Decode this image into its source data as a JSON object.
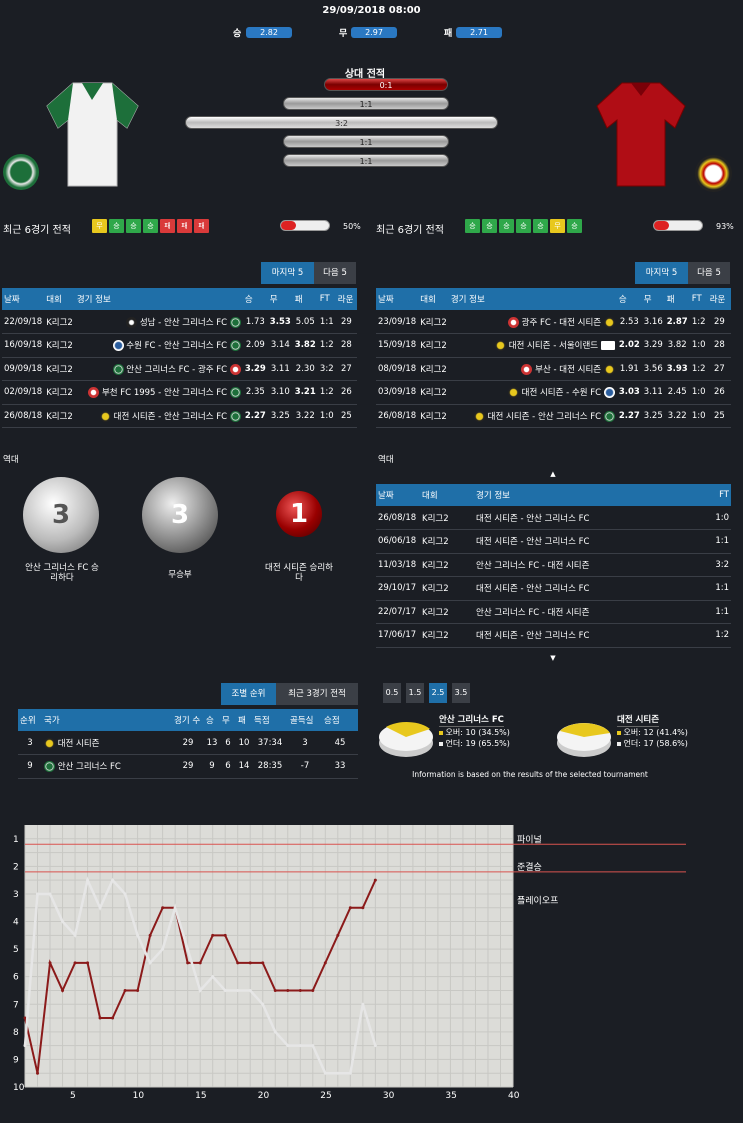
{
  "match": {
    "datetime": "29/09/2018 08:00"
  },
  "odds": {
    "win_label": "승",
    "win": "2.82",
    "draw_label": "무",
    "draw": "2.97",
    "loss_label": "패",
    "loss": "2.71"
  },
  "h2h": {
    "title": "상대 전적",
    "bars": [
      "0:1",
      "1:1",
      "3:2",
      "1:1",
      "1:1"
    ]
  },
  "recent": {
    "label": "최근 6경기 전적",
    "home": {
      "badges": [
        "무",
        "승",
        "승",
        "승",
        "패",
        "패",
        "패"
      ],
      "pct": "50%"
    },
    "away": {
      "badges": [
        "승",
        "승",
        "승",
        "승",
        "승",
        "무",
        "승"
      ],
      "pct": "93%"
    }
  },
  "tabs": {
    "last5": "마지막 5",
    "next5": "다음 5"
  },
  "lastHeaders": {
    "date": "날짜",
    "comp": "대회",
    "info": "경기 정보",
    "w": "승",
    "d": "무",
    "l": "패",
    "ft": "FT",
    "round": "라운"
  },
  "homeLast": [
    {
      "date": "22/09/18",
      "comp": "K리그2",
      "home": "성남",
      "away": "안산 그리너스 FC",
      "w": "1.73",
      "d": "3.53",
      "l": "5.05",
      "ft": "1:1",
      "r": "29"
    },
    {
      "date": "16/09/18",
      "comp": "K리그2",
      "home": "수원 FC",
      "away": "안산 그리너스 FC",
      "w": "2.09",
      "d": "3.14",
      "l": "3.82",
      "ft": "1:2",
      "r": "28"
    },
    {
      "date": "09/09/18",
      "comp": "K리그2",
      "home": "안산 그리너스 FC",
      "away": "광주 FC",
      "w": "3.29",
      "d": "3.11",
      "l": "2.30",
      "ft": "3:2",
      "r": "27"
    },
    {
      "date": "02/09/18",
      "comp": "K리그2",
      "home": "부천 FC 1995",
      "away": "안산 그리너스 FC",
      "w": "2.35",
      "d": "3.10",
      "l": "3.21",
      "ft": "1:2",
      "r": "26"
    },
    {
      "date": "26/08/18",
      "comp": "K리그2",
      "home": "대전 시티즌",
      "away": "안산 그리너스 FC",
      "w": "2.27",
      "d": "3.25",
      "l": "3.22",
      "ft": "1:0",
      "r": "25"
    }
  ],
  "awayLast": [
    {
      "date": "23/09/18",
      "comp": "K리그2",
      "home": "광주 FC",
      "away": "대전 시티즌",
      "w": "2.53",
      "d": "3.16",
      "l": "2.87",
      "ft": "1:2",
      "r": "29"
    },
    {
      "date": "15/09/18",
      "comp": "K리그2",
      "home": "대전 시티즌",
      "away": "서울이랜드",
      "w": "2.02",
      "d": "3.29",
      "l": "3.82",
      "ft": "1:0",
      "r": "28"
    },
    {
      "date": "08/09/18",
      "comp": "K리그2",
      "home": "부산",
      "away": "대전 시티즌",
      "w": "1.91",
      "d": "3.56",
      "l": "3.93",
      "ft": "1:2",
      "r": "27"
    },
    {
      "date": "03/09/18",
      "comp": "K리그2",
      "home": "대전 시티즌",
      "away": "수원 FC",
      "w": "3.03",
      "d": "3.11",
      "l": "2.45",
      "ft": "1:0",
      "r": "26"
    },
    {
      "date": "26/08/18",
      "comp": "K리그2",
      "home": "대전 시티즌",
      "away": "안산 그리너스 FC",
      "w": "2.27",
      "d": "3.25",
      "l": "3.22",
      "ft": "1:0",
      "r": "25"
    }
  ],
  "history": {
    "title": "역대",
    "home_wins": "3",
    "home_label": "안산 그리너스 FC 승리하다",
    "draws": "3",
    "draw_label": "무승부",
    "away_wins": "1",
    "away_label": "대전 시티즌 승리하다"
  },
  "histTable": {
    "headers": {
      "date": "날짜",
      "comp": "대회",
      "info": "경기 정보",
      "ft": "FT"
    },
    "rows": [
      {
        "date": "26/08/18",
        "comp": "K리그2",
        "home": "대전 시티즌",
        "away": "안산 그리너스 FC",
        "ft": "1:0"
      },
      {
        "date": "06/06/18",
        "comp": "K리그2",
        "home": "대전 시티즌",
        "away": "안산 그리너스 FC",
        "ft": "1:1"
      },
      {
        "date": "11/03/18",
        "comp": "K리그2",
        "home": "안산 그리너스 FC",
        "away": "대전 시티즌",
        "ft": "3:2"
      },
      {
        "date": "29/10/17",
        "comp": "K리그2",
        "home": "대전 시티즌",
        "away": "안산 그리너스 FC",
        "ft": "1:1"
      },
      {
        "date": "22/07/17",
        "comp": "K리그2",
        "home": "안산 그리너스 FC",
        "away": "대전 시티즌",
        "ft": "1:1"
      },
      {
        "date": "17/06/17",
        "comp": "K리그2",
        "home": "대전 시티즌",
        "away": "안산 그리너스 FC",
        "ft": "1:2"
      }
    ]
  },
  "standings": {
    "tab1": "조별 순위",
    "tab2": "최근 3경기 전적",
    "headers": {
      "rank": "순위",
      "team": "국가",
      "played": "경기 수",
      "w": "승",
      "d": "무",
      "l": "패",
      "goals": "득점",
      "gd": "골득실",
      "pts": "승점"
    },
    "rows": [
      {
        "rank": "3",
        "team": "대전 시티즌",
        "played": "29",
        "w": "13",
        "d": "6",
        "l": "10",
        "goals": "37:34",
        "gd": "3",
        "pts": "45"
      },
      {
        "rank": "9",
        "team": "안산 그리너스 FC",
        "played": "29",
        "w": "9",
        "d": "6",
        "l": "14",
        "goals": "28:35",
        "gd": "-7",
        "pts": "33"
      }
    ]
  },
  "ou": {
    "lines": [
      "0.5",
      "1.5",
      "2.5",
      "3.5"
    ],
    "active": "2.5",
    "home": {
      "team": "안산 그리너스 FC",
      "over": "오버: 10 (34.5%)",
      "under": "언더: 19 (65.5%)"
    },
    "away": {
      "team": "대전 시티즌",
      "over": "오버: 12 (41.4%)",
      "under": "언더: 17 (58.6%)"
    },
    "note": "Information is based on the results of the selected tournament"
  },
  "chart_data": {
    "type": "line",
    "x": [
      1,
      2,
      3,
      4,
      5,
      6,
      7,
      8,
      9,
      10,
      11,
      12,
      13,
      14,
      15,
      16,
      17,
      18,
      19,
      20,
      21,
      22,
      23,
      24,
      25,
      26,
      27,
      28,
      29
    ],
    "series": [
      {
        "color": "#8b1a1a",
        "values": [
          7.5,
          9.5,
          5.5,
          6.5,
          5.5,
          5.5,
          7.5,
          7.5,
          6.5,
          6.5,
          4.5,
          3.5,
          3.5,
          5.5,
          5.5,
          4.5,
          4.5,
          5.5,
          5.5,
          5.5,
          6.5,
          6.5,
          6.5,
          6.5,
          5.5,
          4.5,
          3.5,
          3.5,
          2.5
        ]
      },
      {
        "color": "#e6e6e6",
        "values": [
          8.5,
          3,
          3,
          4,
          4.5,
          2.5,
          3.5,
          2.5,
          3,
          4.5,
          5.5,
          5,
          3.5,
          5,
          6.5,
          6,
          6.5,
          6.5,
          6.5,
          7,
          8,
          8.5,
          8.5,
          8.5,
          9.5,
          9.5,
          9.5,
          7,
          8.5
        ]
      }
    ],
    "ylim": [
      10,
      0.5
    ],
    "xlim": [
      1,
      40
    ],
    "yticks": [
      "1",
      "2",
      "3",
      "4",
      "5",
      "6",
      "7",
      "8",
      "9",
      "10"
    ],
    "xticks": [
      "5",
      "10",
      "15",
      "20",
      "25",
      "30",
      "35",
      "40"
    ],
    "annotations": [
      "파이널",
      "준결승",
      "플레이오프"
    ],
    "grid": true
  }
}
